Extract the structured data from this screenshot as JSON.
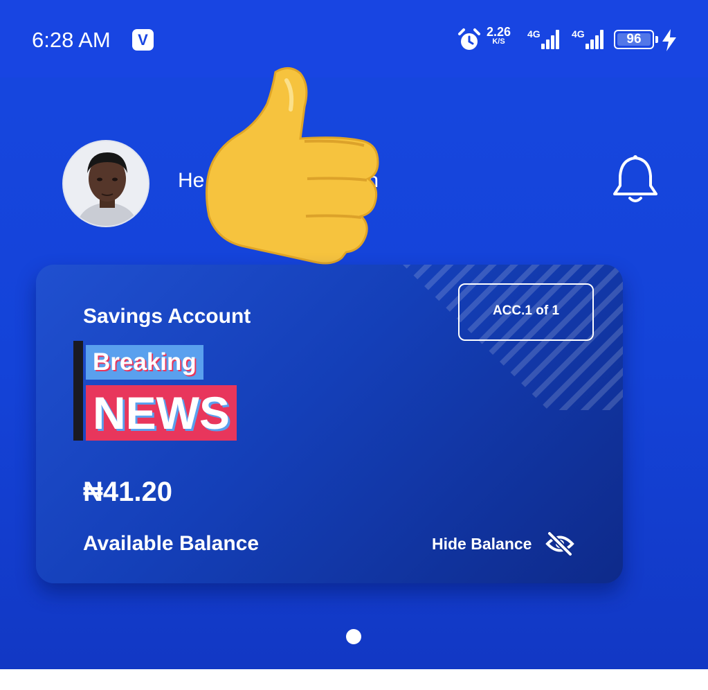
{
  "status_bar": {
    "time": "6:28 AM",
    "app_icon_letter": "V",
    "net_speed": "2.26",
    "net_speed_unit": "K/S",
    "sim1_network": "4G",
    "sim2_network": "4G",
    "battery_percent": "96",
    "icons": [
      "alarm-icon",
      "signal-icon",
      "battery-icon",
      "charging-bolt-icon"
    ]
  },
  "header": {
    "greeting_visible": "He",
    "greeting_tail": "n",
    "overlay_sticker": "thumbs-up-icon",
    "notification_icon": "bell-icon"
  },
  "account_card": {
    "title": "Savings Account",
    "account_counter": "ACC.1 of 1",
    "overlay_breaking": "Breaking",
    "overlay_news": "NEWS",
    "balance": "₦41.20",
    "balance_label": "Available Balance",
    "hide_balance_label": "Hide Balance",
    "hide_icon": "eye-off-icon"
  },
  "pager": {
    "active_page": 1,
    "total_pages": 1
  },
  "colors": {
    "primary_blue": "#1747e0",
    "card_blue_dark": "#0e2a8a",
    "news_red": "#e8365c",
    "breaking_blue": "#5aa0ee"
  }
}
